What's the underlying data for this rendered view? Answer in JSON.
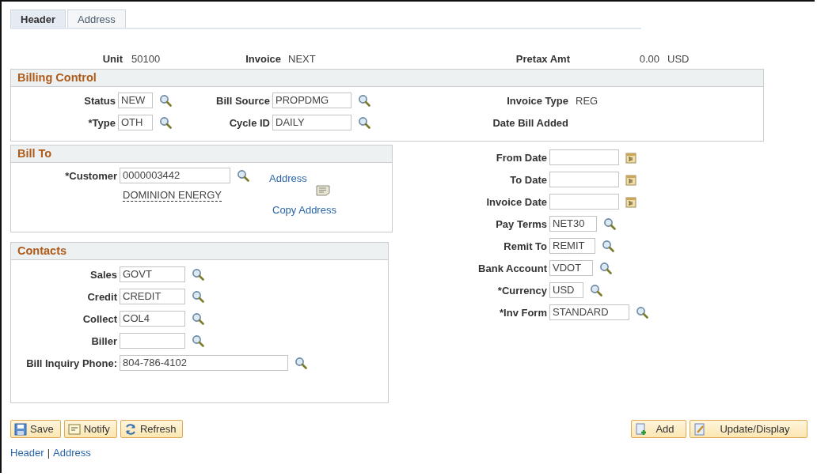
{
  "tabs": [
    {
      "label": "Header",
      "selected": true
    },
    {
      "label": "Address",
      "selected": false
    }
  ],
  "summary": [
    {
      "label": "Unit",
      "value": "50100"
    },
    {
      "label": "Invoice",
      "value": "NEXT"
    },
    {
      "label": "Pretax Amt",
      "value": "0.00",
      "currency": "USD"
    }
  ],
  "billing_control": {
    "title": "Billing Control",
    "columns": [
      [
        {
          "label": "Status",
          "value": "NEW",
          "kind": "lookup"
        },
        {
          "label": "*Type",
          "value": "OTH",
          "kind": "lookup"
        }
      ],
      [
        {
          "label": "Bill Source",
          "value": "PROPDMG",
          "kind": "lookup"
        },
        {
          "label": "Cycle ID",
          "value": "DAILY",
          "kind": "lookup"
        }
      ],
      [
        {
          "label": "Invoice Type",
          "value": "REG",
          "kind": "display"
        },
        {
          "label": "Date Bill Added",
          "kind": "display"
        }
      ]
    ]
  },
  "bill_to": {
    "title": "Bill To",
    "customer": {
      "label": "*Customer",
      "value": "0000003442"
    },
    "customer_name": "DOMINION ENERGY",
    "address_link": "Address",
    "copy_address_link": "Copy Address"
  },
  "contacts": {
    "title": "Contacts",
    "fields": [
      {
        "label": "Sales",
        "value": "GOVT"
      },
      {
        "label": "Credit",
        "value": "CREDIT"
      },
      {
        "label": "Collect",
        "value": "COL4"
      },
      {
        "label": "Biller"
      },
      {
        "label": "Bill Inquiry Phone:",
        "value": "804-786-4102"
      }
    ]
  },
  "invoice_fields": [
    {
      "label": "From Date",
      "kind": "date"
    },
    {
      "label": "To Date",
      "kind": "date"
    },
    {
      "label": "Invoice Date",
      "kind": "date"
    },
    {
      "label": "Pay Terms",
      "value": "NET30",
      "kind": "lookup"
    },
    {
      "label": "Remit To",
      "value": "REMIT",
      "kind": "lookup"
    },
    {
      "label": "Bank Account",
      "value": "VDOT",
      "kind": "lookup"
    },
    {
      "label": "*Currency",
      "value": "USD",
      "kind": "lookup"
    },
    {
      "label": "*Inv Form",
      "value": "STANDARD",
      "kind": "lookup"
    }
  ],
  "buttons_left": [
    "Save",
    "Notify",
    "Refresh"
  ],
  "buttons_right": [
    "Add",
    "Update/Display"
  ],
  "footer_links": {
    "items": [
      "Header",
      "Address"
    ],
    "separator": "|"
  }
}
